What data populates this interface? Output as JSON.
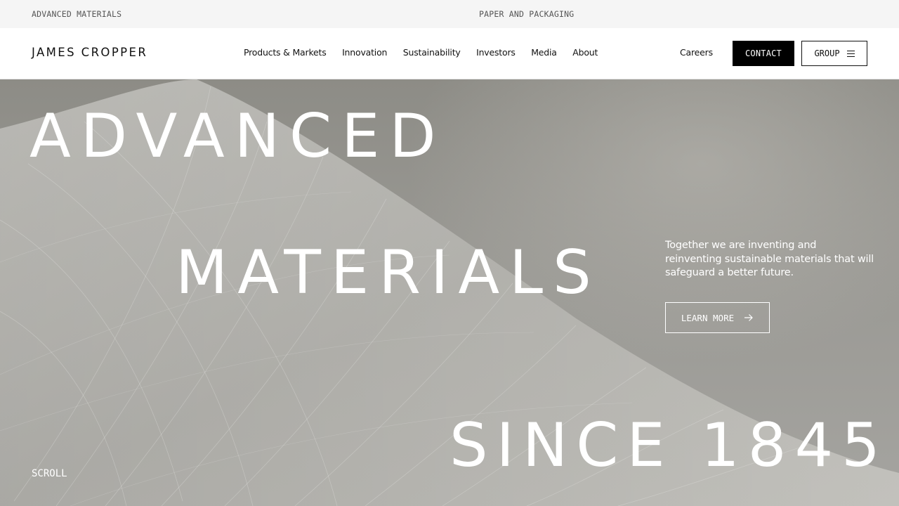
{
  "topbar": {
    "left_link": "ADVANCED MATERIALS",
    "center_link": "PAPER AND PACKAGING"
  },
  "header": {
    "logo": "JAMES CROPPER",
    "nav": [
      {
        "label": "Products & Markets"
      },
      {
        "label": "Innovation"
      },
      {
        "label": "Sustainability"
      },
      {
        "label": "Investors"
      },
      {
        "label": "Media"
      },
      {
        "label": "About"
      }
    ],
    "careers": "Careers",
    "contact": "CONTACT",
    "group": "GROUP"
  },
  "hero": {
    "line1": "ADVANCED",
    "line2": "MATERIALS",
    "line3": "SINCE 1845",
    "tagline": "Together we are inventing and reinventing sustainable materials that will safeguard a better future.",
    "cta": "LEARN MORE",
    "scroll": "SCROLL"
  },
  "colors": {
    "topbar_bg": "#f5f5f5",
    "contact_bg": "#000000",
    "hero_text": "#ffffff"
  },
  "icons": [
    "menu-icon",
    "arrow-right-icon"
  ]
}
